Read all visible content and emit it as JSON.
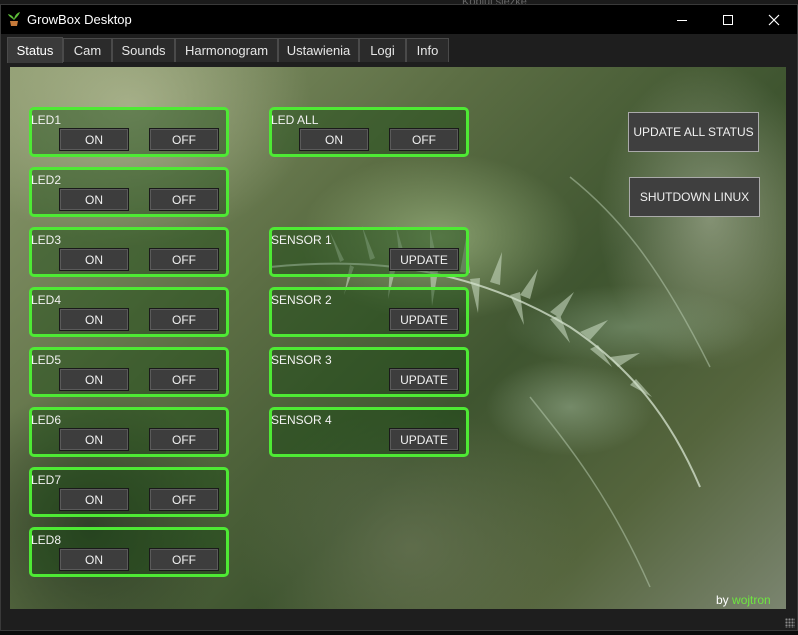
{
  "window": {
    "title": "GrowBox Desktop",
    "behind_text": "Kobiui siezke"
  },
  "tabs": [
    {
      "label": "Status",
      "active": true
    },
    {
      "label": "Cam",
      "active": false
    },
    {
      "label": "Sounds",
      "active": false
    },
    {
      "label": "Harmonogram",
      "active": false
    },
    {
      "label": "Ustawienia",
      "active": false
    },
    {
      "label": "Logi",
      "active": false
    },
    {
      "label": "Info",
      "active": false
    }
  ],
  "leds": [
    {
      "label": "LED1",
      "on": "ON",
      "off": "OFF"
    },
    {
      "label": "LED2",
      "on": "ON",
      "off": "OFF"
    },
    {
      "label": "LED3",
      "on": "ON",
      "off": "OFF"
    },
    {
      "label": "LED4",
      "on": "ON",
      "off": "OFF"
    },
    {
      "label": "LED5",
      "on": "ON",
      "off": "OFF"
    },
    {
      "label": "LED6",
      "on": "ON",
      "off": "OFF"
    },
    {
      "label": "LED7",
      "on": "ON",
      "off": "OFF"
    },
    {
      "label": "LED8",
      "on": "ON",
      "off": "OFF"
    }
  ],
  "led_all": {
    "label": "LED ALL",
    "on": "ON",
    "off": "OFF"
  },
  "sensors": [
    {
      "label": "SENSOR 1",
      "button": "UPDATE"
    },
    {
      "label": "SENSOR 2",
      "button": "UPDATE"
    },
    {
      "label": "SENSOR 3",
      "button": "UPDATE"
    },
    {
      "label": "SENSOR 4",
      "button": "UPDATE"
    }
  ],
  "actions": {
    "update_all": "UPDATE ALL STATUS",
    "shutdown": "SHUTDOWN LINUX"
  },
  "credit": {
    "prefix": "by",
    "author": "wojtron"
  },
  "colors": {
    "panel_border": "#4eea34",
    "author": "#6ee640",
    "titlebar": "#000000"
  },
  "icons": [
    "app-plant-icon",
    "minimize-icon",
    "maximize-icon",
    "close-icon",
    "resize-grip-icon"
  ]
}
